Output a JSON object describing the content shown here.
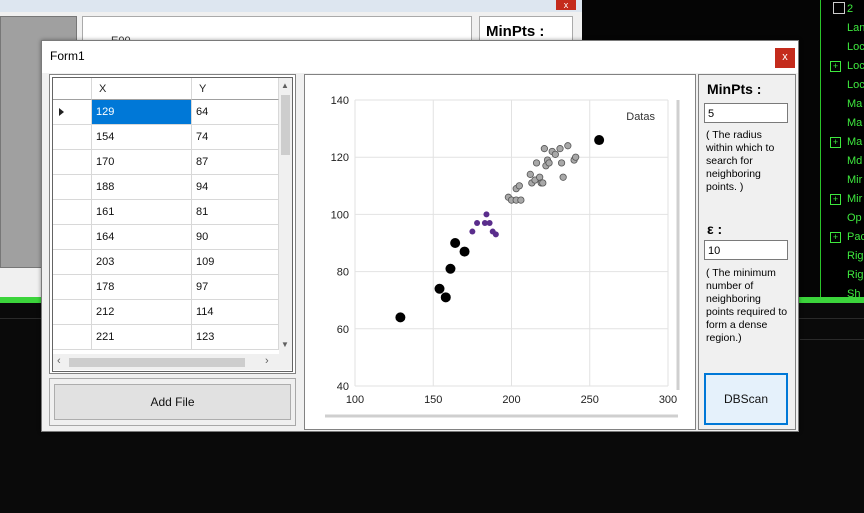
{
  "background": {
    "partial_label": "E00",
    "minpts_label": "MinPts :",
    "close_label": "x",
    "terminal_items": [
      {
        "label": "Lan",
        "expandable": false
      },
      {
        "label": "Loc",
        "expandable": false
      },
      {
        "label": "Loc",
        "expandable": true
      },
      {
        "label": "Loc",
        "expandable": false
      },
      {
        "label": "Ma",
        "expandable": false
      },
      {
        "label": "Ma",
        "expandable": false
      },
      {
        "label": "Ma",
        "expandable": true
      },
      {
        "label": "Md",
        "expandable": false
      },
      {
        "label": "Mir",
        "expandable": false
      },
      {
        "label": "Mir",
        "expandable": true
      },
      {
        "label": "Op",
        "expandable": false
      },
      {
        "label": "Pac",
        "expandable": true
      },
      {
        "label": "Rig",
        "expandable": false
      },
      {
        "label": "Rig",
        "expandable": false
      },
      {
        "label": "Sh",
        "expandable": false
      }
    ],
    "terminal_header": "2"
  },
  "form": {
    "title": "Form1",
    "close_label": "x"
  },
  "grid": {
    "columns": [
      "X",
      "Y"
    ],
    "rows": [
      {
        "x": "129",
        "y": "64"
      },
      {
        "x": "154",
        "y": "74"
      },
      {
        "x": "170",
        "y": "87"
      },
      {
        "x": "188",
        "y": "94"
      },
      {
        "x": "161",
        "y": "81"
      },
      {
        "x": "164",
        "y": "90"
      },
      {
        "x": "203",
        "y": "109"
      },
      {
        "x": "178",
        "y": "97"
      },
      {
        "x": "212",
        "y": "114"
      },
      {
        "x": "221",
        "y": "123"
      }
    ],
    "selected_row": 0
  },
  "add_file_label": "Add File",
  "side": {
    "minpts_label": "MinPts :",
    "minpts_value": "5",
    "minpts_help": "( The radius within which to search for  neighboring points. )",
    "eps_label": "ε :",
    "eps_value": "10",
    "eps_help": "( The minimum number of neighboring points required to form a dense region.)",
    "dbscan_label": "DBScan"
  },
  "chart_data": {
    "type": "scatter",
    "legend": "Datas",
    "legend_position": "top-right",
    "xlim": [
      100,
      300
    ],
    "ylim": [
      40,
      140
    ],
    "xticks": [
      100,
      150,
      200,
      250,
      300
    ],
    "yticks": [
      40,
      60,
      80,
      100,
      120,
      140
    ],
    "grid": true,
    "colors": {
      "noise": "#000000",
      "cluster1": "#5a2d8c",
      "cluster2": "#8c8c8c"
    },
    "series": [
      {
        "group": "noise",
        "points": [
          [
            129,
            64
          ],
          [
            154,
            74
          ],
          [
            158,
            71
          ],
          [
            161,
            81
          ],
          [
            164,
            90
          ],
          [
            170,
            87
          ],
          [
            256,
            126
          ]
        ]
      },
      {
        "group": "cluster1",
        "points": [
          [
            175,
            94
          ],
          [
            178,
            97
          ],
          [
            183,
            97
          ],
          [
            184,
            100
          ],
          [
            186,
            97
          ],
          [
            188,
            94
          ],
          [
            190,
            93
          ]
        ]
      },
      {
        "group": "cluster2",
        "points": [
          [
            198,
            106
          ],
          [
            200,
            105
          ],
          [
            203,
            109
          ],
          [
            203,
            105
          ],
          [
            205,
            110
          ],
          [
            206,
            105
          ],
          [
            212,
            114
          ],
          [
            213,
            111
          ],
          [
            215,
            112
          ],
          [
            216,
            118
          ],
          [
            218,
            113
          ],
          [
            219,
            111
          ],
          [
            220,
            111
          ],
          [
            221,
            123
          ],
          [
            222,
            117
          ],
          [
            223,
            119
          ],
          [
            224,
            118
          ],
          [
            226,
            122
          ],
          [
            228,
            121
          ],
          [
            231,
            123
          ],
          [
            232,
            118
          ],
          [
            233,
            113
          ],
          [
            236,
            124
          ],
          [
            240,
            119
          ],
          [
            241,
            120
          ]
        ]
      }
    ]
  }
}
